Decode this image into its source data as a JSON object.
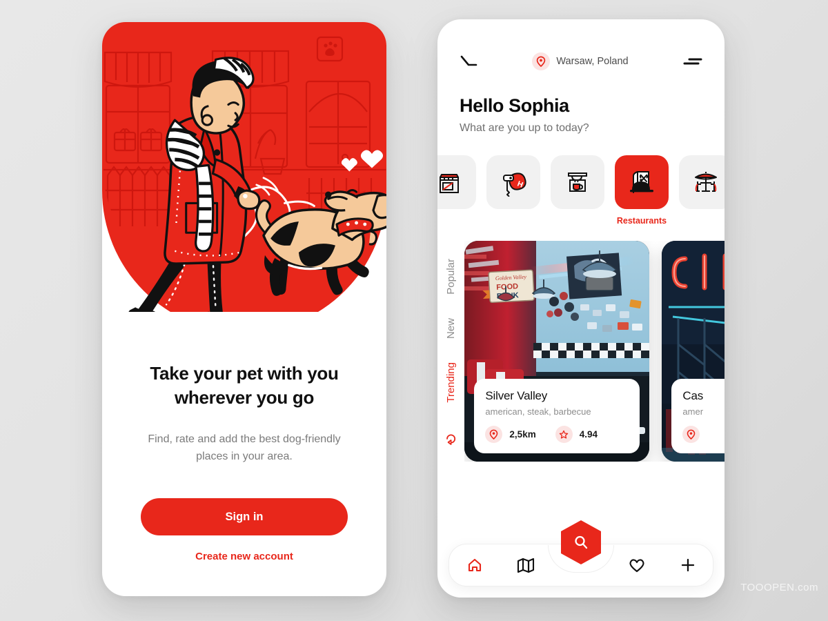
{
  "theme": {
    "brand_red": "#E8271B",
    "page_background": "#E4E4E4",
    "card_dark": "#101010",
    "muted_text": "#8C8C8C"
  },
  "onboarding_screen": {
    "illustration": {
      "name": "woman-walking-dog-illustration",
      "description": "Woman in red coat with striped scarf walking a dog on a leash in front of a storefront street, red background"
    },
    "headline": "Take your pet with you wherever you go",
    "subcopy": "Find, rate and add the best dog-friendly places in your area.",
    "primary_button": "Sign in",
    "secondary_link": "Create new account"
  },
  "home_screen": {
    "header": {
      "back_icon": "back-arrow-icon",
      "location": "Warsaw, Poland",
      "location_icon": "map-pin-icon",
      "menu_icon": "hamburger-menu-icon"
    },
    "greeting": {
      "title": "Hello Sophia",
      "subtitle": "What are you up to today?"
    },
    "categories": [
      {
        "icon": "shop-icon",
        "label": "",
        "active": false
      },
      {
        "icon": "hotel-key-icon",
        "label": "",
        "active": false
      },
      {
        "icon": "cafe-sign-icon",
        "label": "",
        "active": false
      },
      {
        "icon": "restaurant-icon",
        "label": "Restaurants",
        "active": true
      },
      {
        "icon": "patio-table-icon",
        "label": "",
        "active": false
      }
    ],
    "filter_tabs": [
      {
        "label": "Popular",
        "active": false,
        "icon": ""
      },
      {
        "label": "New",
        "active": false,
        "icon": ""
      },
      {
        "label": "Trending",
        "active": true,
        "icon": "trending-icon"
      }
    ],
    "places": [
      {
        "name": "Silver Valley",
        "tags": "american, steak, barbecue",
        "distance": "2,5km",
        "rating": "4.94",
        "distance_icon": "map-pin-icon",
        "rating_icon": "star-icon",
        "photo": "retro-american-diner-red-booths"
      },
      {
        "name": "Cas",
        "tags": "amer",
        "distance": "",
        "rating": "",
        "distance_icon": "map-pin-icon",
        "rating_icon": "star-icon",
        "photo": "neon-sign-night-exterior"
      }
    ],
    "bottom_nav": {
      "items": [
        {
          "icon": "home-icon",
          "active": true
        },
        {
          "icon": "map-icon",
          "active": false
        },
        {
          "icon": "heart-icon",
          "active": false
        },
        {
          "icon": "plus-icon",
          "active": false
        }
      ],
      "fab_icon": "search-icon"
    }
  },
  "watermark": "TOOOPEN.com"
}
